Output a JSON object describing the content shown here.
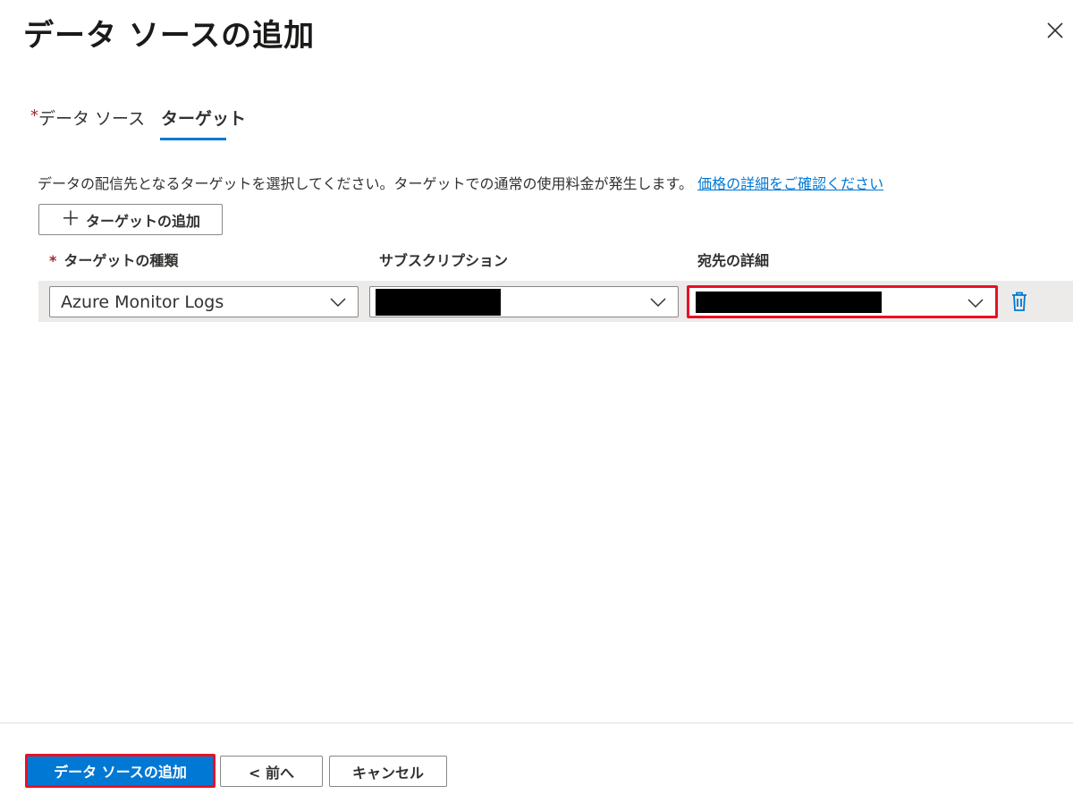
{
  "header": {
    "title": "データ ソースの追加",
    "close_icon": "close-icon"
  },
  "tabs": [
    {
      "label": "データ ソース",
      "required_mark": "*"
    },
    {
      "label": "ターゲット",
      "selected": true
    }
  ],
  "description": {
    "text": "データの配信先となるターゲットを選択してください。ターゲットでの通常の使用料金が発生します。",
    "link": "価格の詳細をご確認ください"
  },
  "add_target": {
    "plus": "＋",
    "label": "ターゲットの追加"
  },
  "table": {
    "headers": {
      "required_mark": "*",
      "target_type": "ターゲットの種類",
      "subscription": "サブスクリプション",
      "destination": "宛先の詳細"
    },
    "row": {
      "target_type": "Azure Monitor Logs",
      "subscription": "",
      "destination": ""
    }
  },
  "footer": {
    "primary": "データ ソースの追加",
    "prev": "< 前へ",
    "cancel": "キャンセル"
  },
  "colors": {
    "accent": "#0078d4",
    "highlight": "#e81123",
    "row_bg": "#edebe9"
  }
}
